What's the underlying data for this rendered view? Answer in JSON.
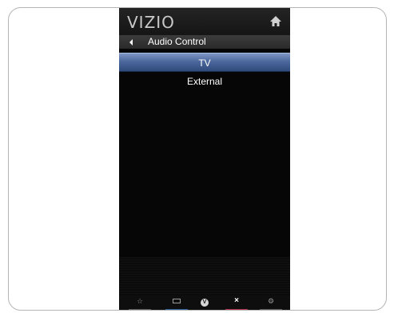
{
  "header": {
    "logo_text": "VIZIO"
  },
  "menu": {
    "title": "Audio Control",
    "options": [
      {
        "label": "TV",
        "selected": true
      },
      {
        "label": "External",
        "selected": false
      }
    ]
  },
  "bottom_bar": {
    "buttons": [
      {
        "icon": "star-icon",
        "glyph": "☆",
        "color": "#5a5a5a"
      },
      {
        "icon": "input-icon",
        "glyph": "",
        "color": "#2d5d9a"
      },
      {
        "icon": "v-icon",
        "glyph": "V",
        "color": "#0e0e0e"
      },
      {
        "icon": "close-icon",
        "glyph": "×",
        "color": "#b0304a"
      },
      {
        "icon": "settings-icon",
        "glyph": "⚙",
        "color": "#5a5a5a"
      }
    ]
  },
  "colors": {
    "selection": "#4c689d",
    "panel": "#060606"
  }
}
